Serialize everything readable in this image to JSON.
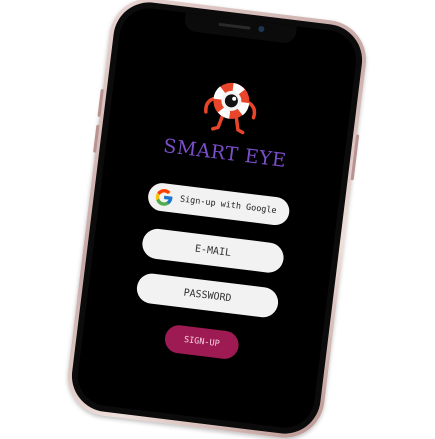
{
  "app": {
    "title": "SMART EYE"
  },
  "google_signup": {
    "label": "Sign-up with Google",
    "icon": "google-g-icon"
  },
  "email": {
    "placeholder": "E-MAIL",
    "value": ""
  },
  "password": {
    "placeholder": "PASSWORD",
    "value": ""
  },
  "signup_button": {
    "label": "SIGN-UP"
  },
  "mascot": {
    "icon": "eye-mascot-icon"
  },
  "colors": {
    "screen_background": "#000000",
    "title": "#7b4fc9",
    "signup_button": "#9e1a52",
    "field_background": "#f2f2f2",
    "mascot_ring": "#e8452b"
  }
}
